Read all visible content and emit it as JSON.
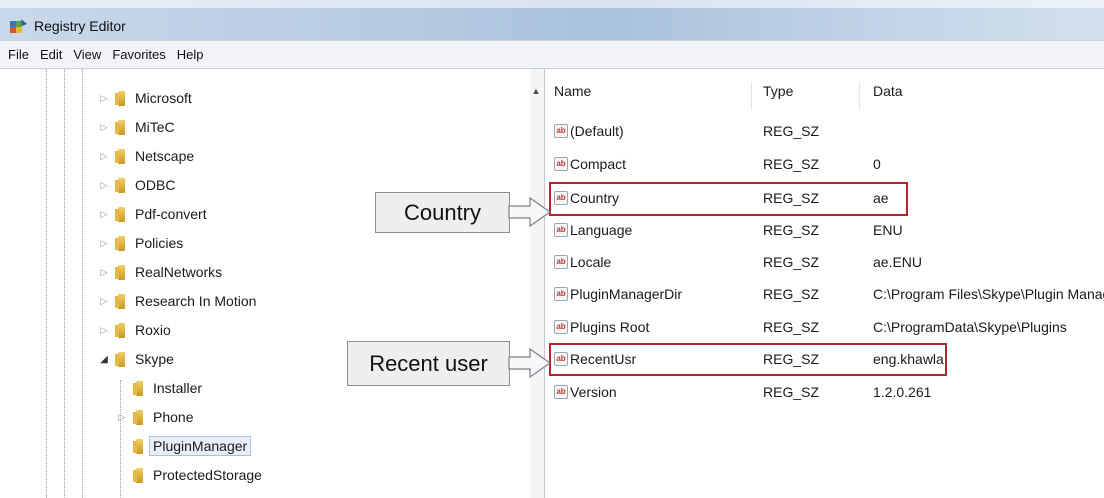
{
  "window": {
    "title": "Registry Editor"
  },
  "menu": [
    "File",
    "Edit",
    "View",
    "Favorites",
    "Help"
  ],
  "tree": {
    "nodes": [
      {
        "label": "Microsoft",
        "expander": "▷"
      },
      {
        "label": "MiTeC",
        "expander": "▷"
      },
      {
        "label": "Netscape",
        "expander": "▷"
      },
      {
        "label": "ODBC",
        "expander": "▷"
      },
      {
        "label": "Pdf-convert",
        "expander": "▷"
      },
      {
        "label": "Policies",
        "expander": "▷"
      },
      {
        "label": "RealNetworks",
        "expander": "▷"
      },
      {
        "label": "Research In Motion",
        "expander": "▷"
      },
      {
        "label": "Roxio",
        "expander": "▷"
      },
      {
        "label": "Skype",
        "expander": "◢"
      },
      {
        "label": "Installer",
        "expander": ""
      },
      {
        "label": "Phone",
        "expander": "▷"
      },
      {
        "label": "PluginManager",
        "expander": ""
      },
      {
        "label": "ProtectedStorage",
        "expander": ""
      }
    ]
  },
  "values": {
    "columns": {
      "name": "Name",
      "type": "Type",
      "data": "Data"
    },
    "icon_label": "ab",
    "rows": [
      {
        "name": "(Default)",
        "type": "REG_SZ",
        "data": ""
      },
      {
        "name": "Compact",
        "type": "REG_SZ",
        "data": "0"
      },
      {
        "name": "Country",
        "type": "REG_SZ",
        "data": "ae"
      },
      {
        "name": "Language",
        "type": "REG_SZ",
        "data": "ENU"
      },
      {
        "name": "Locale",
        "type": "REG_SZ",
        "data": "ae.ENU"
      },
      {
        "name": "PluginManagerDir",
        "type": "REG_SZ",
        "data": "C:\\Program Files\\Skype\\Plugin Manager\\"
      },
      {
        "name": "Plugins Root",
        "type": "REG_SZ",
        "data": "C:\\ProgramData\\Skype\\Plugins"
      },
      {
        "name": "RecentUsr",
        "type": "REG_SZ",
        "data": "eng.khawla"
      },
      {
        "name": "Version",
        "type": "REG_SZ",
        "data": "1.2.0.261"
      }
    ]
  },
  "annotations": {
    "country_label": "Country",
    "recent_label": "Recent user"
  },
  "colors": {
    "highlight": "#b3262b",
    "callout_bg": "#eeeeee"
  }
}
